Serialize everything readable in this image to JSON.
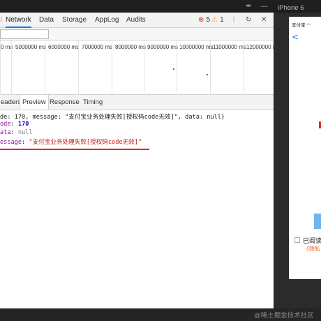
{
  "window": {
    "simulator_title": "iPhone 6",
    "topbar_icons": [
      "vector-pen-icon",
      "minus-icon"
    ]
  },
  "devtools": {
    "tabs": [
      {
        "label": "Network",
        "active": true
      },
      {
        "label": "Data",
        "active": false
      },
      {
        "label": "Storage",
        "active": false
      },
      {
        "label": "AppLog",
        "active": false
      },
      {
        "label": "Audits",
        "active": false
      }
    ],
    "error_count": "5",
    "warning_count": "1",
    "filter": {
      "value": "",
      "placeholder": ""
    },
    "timeline_ticks": [
      "0 ms",
      "5000000 ms",
      "6000000 ms",
      "7000000 ms",
      "8000000 ms",
      "9000000 ms",
      "10000000 ms",
      "11000000 ms",
      "12000000 ms"
    ],
    "subtabs": [
      {
        "label": "eaders",
        "active": false
      },
      {
        "label": "Preview",
        "active": true
      },
      {
        "label": "Response",
        "active": false
      },
      {
        "label": "Timing",
        "active": false
      }
    ],
    "preview": {
      "summary": "de: 170, message: \"支付宝业务处理失败[授权码code无效]\", data: null}",
      "code_key": "ode",
      "code_value": "170",
      "data_key": "ata",
      "data_value": "null",
      "message_key": "essage",
      "message_value": "\"支付宝业务处理失败[授权码code无效]\""
    },
    "colors": {
      "error": "#d93025",
      "warning": "#f2a600",
      "highlight_underline": "#e8232a",
      "active_tab": "#1a73e8"
    }
  },
  "simulator": {
    "status_text": "支付宝 ◠",
    "back_glyph": "<",
    "agree_text": "已阅读",
    "privacy_text": "《隐私"
  },
  "footer": {
    "watermark": "@稀土掘金技术社区"
  }
}
